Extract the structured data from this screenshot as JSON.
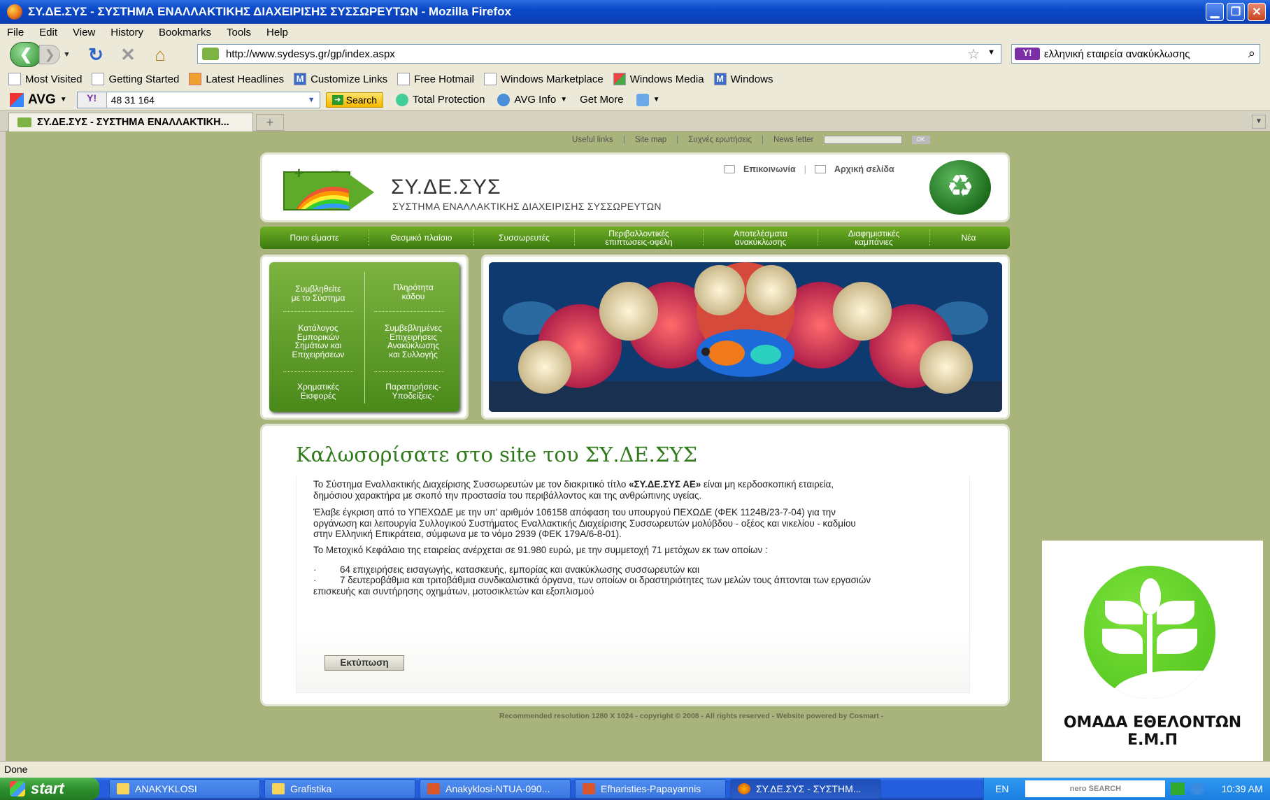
{
  "window": {
    "title": "ΣΥ.ΔΕ.ΣΥΣ - ΣΥΣΤΗΜΑ ΕΝΑΛΛΑΚΤΙΚΗΣ ΔΙΑΧΕΙΡΙΣΗΣ ΣΥΣΣΩΡΕΥΤΩΝ - Mozilla Firefox"
  },
  "menu": [
    "File",
    "Edit",
    "View",
    "History",
    "Bookmarks",
    "Tools",
    "Help"
  ],
  "nav": {
    "url": "http://www.sydesys.gr/gp/index.aspx",
    "search_value": "ελληνική εταιρεία ανακύκλωσης",
    "search_badge": "Y!"
  },
  "bookmarks": [
    {
      "label": "Most Visited",
      "icon": "most-visited-icon"
    },
    {
      "label": "Getting Started",
      "icon": "page-icon"
    },
    {
      "label": "Latest Headlines",
      "icon": "feed-icon"
    },
    {
      "label": "Customize Links",
      "icon": "msn-icon"
    },
    {
      "label": "Free Hotmail",
      "icon": "page-icon"
    },
    {
      "label": "Windows Marketplace",
      "icon": "page-icon"
    },
    {
      "label": "Windows Media",
      "icon": "windows-icon"
    },
    {
      "label": "Windows",
      "icon": "msn-icon"
    }
  ],
  "avg": {
    "logo": "AVG",
    "yahoo_badge": "Y!",
    "input_value": "48 31 164",
    "search_label": "Search",
    "total_protection": "Total Protection",
    "avg_info": "AVG Info",
    "get_more": "Get More"
  },
  "tab": {
    "label": "ΣΥ.ΔΕ.ΣΥΣ - ΣΥΣΤΗΜΑ ΕΝΑΛΛΑΚΤΙΚΗ...",
    "new_tab": "+"
  },
  "site": {
    "toplinks": {
      "useful": "Useful links",
      "sitemap": "Site map",
      "faq": "Συχνές ερωτήσεις",
      "newsletter": "News letter",
      "ok": "OK"
    },
    "brand": "ΣΥ.ΔΕ.ΣΥΣ",
    "brand_sub": "ΣΥΣΤΗΜΑ ΕΝΑΛΛΑΚΤΙΚΗΣ ΔΙΑΧΕΙΡΙΣΗΣ ΣΥΣΣΩΡΕΥΤΩΝ",
    "header_links": {
      "contact": "Επικοινωνία",
      "home": "Αρχική σελίδα"
    },
    "menu": [
      [
        "Ποιοι είμαστε",
        ""
      ],
      [
        "Θεσμικό πλαίσιο",
        ""
      ],
      [
        "Συσσωρευτές",
        ""
      ],
      [
        "Περιβαλλοντικές",
        "επιπτώσεις-οφέλη"
      ],
      [
        "Αποτελέσματα",
        "ανακύκλωσης"
      ],
      [
        "Διαφημιστικές",
        "καμπάνιες"
      ],
      [
        "Νέα",
        ""
      ]
    ],
    "side": [
      [
        "Συμβληθείτε",
        "με το Σύστημα"
      ],
      [
        "Πληρότητα",
        "κάδου"
      ],
      [
        "Κατάλογος",
        "Εμπορικών",
        "Σημάτων και",
        "Επιχειρήσεων"
      ],
      [
        "Συμβεβλημένες",
        "Επιχειρήσεις",
        "Ανακύκλωσης",
        "και Συλλογής"
      ],
      [
        "Χρηματικές",
        "Εισφορές"
      ],
      [
        "Παρατηρήσεις-",
        "Υποδείξεις-"
      ]
    ],
    "main_title": "Καλωσορίσατε στο site του ΣΥ.ΔΕ.ΣΥΣ",
    "para1_a": "Το Σύστημα Εναλλακτικής Διαχείρισης Συσσωρευτών με τον διακριτικό τίτλο ",
    "para1_bold": "«ΣΥ.ΔΕ.ΣΥΣ ΑΕ»",
    "para1_b": " είναι μη κερδοσκοπική εταιρεία,",
    "para1_line2": "δημόσιου χαρακτήρα με σκοπό την προστασία του περιβάλλοντος και της ανθρώπινης υγείας.",
    "para2_l1": "Έλαβε έγκριση από το ΥΠΕΧΩΔΕ με την υπ' αριθμόν 106158 απόφαση του υπουργού ΠΕΧΩΔΕ (ΦΕΚ 1124Β/23-7-04) για την",
    "para2_l2": "οργάνωση και λειτουργία Συλλογικού Συστήματος Εναλλακτικής Διαχείρισης Συσσωρευτών μολύβδου - οξέος και νικελίου - καδμίου",
    "para2_l3": "στην Ελληνική Επικράτεια, σύμφωνα με το νόμο 2939 (ΦΕΚ 179Α/6-8-01).",
    "para3": "Το Μετοχικό Κεφάλαιο της εταιρείας ανέρχεται σε 91.980 ευρώ, με την συμμετοχή 71 μετόχων εκ των οποίων  :",
    "bullet1": "64 επιχειρήσεις εισαγωγής, κατασκευής, εμπορίας και ανακύκλωσης συσσωρευτών και",
    "bullet2_l1": "7 δευτεροβάθμια και τριτοβάθμια συνδικαλιστικά όργανα, των οποίων οι δραστηριότητες των μελών τους άπτονται των εργασιών",
    "bullet2_l2": "επισκευής και συντήρησης οχημάτων, μοτοσικλετών και εξοπλισμού",
    "print": "Εκτύπωση",
    "footer": "Recommended resolution 1280 X 1024 - copyright © 2008 - All rights reserved - Website powered by Cosmart -"
  },
  "overlay_logo": {
    "text": "ΟΜΑΔΑ ΕΘΕΛΟΝΤΩΝ Ε.Μ.Π"
  },
  "status": "Done",
  "taskbar": {
    "start": "start",
    "tasks": [
      {
        "label": "ANAKYKLOSI",
        "icon": "folder-icon"
      },
      {
        "label": "Grafistika",
        "icon": "folder-icon"
      },
      {
        "label": "Anakyklosi-NTUA-090...",
        "icon": "powerpoint-icon"
      },
      {
        "label": "Efharisties-Papayannis",
        "icon": "powerpoint-icon"
      },
      {
        "label": "ΣΥ.ΔΕ.ΣΥΣ - ΣΥΣΤΗΜ...",
        "icon": "firefox-icon"
      }
    ],
    "lang": "EN",
    "nero": "nero SEARCH",
    "clock": "10:39 AM"
  }
}
